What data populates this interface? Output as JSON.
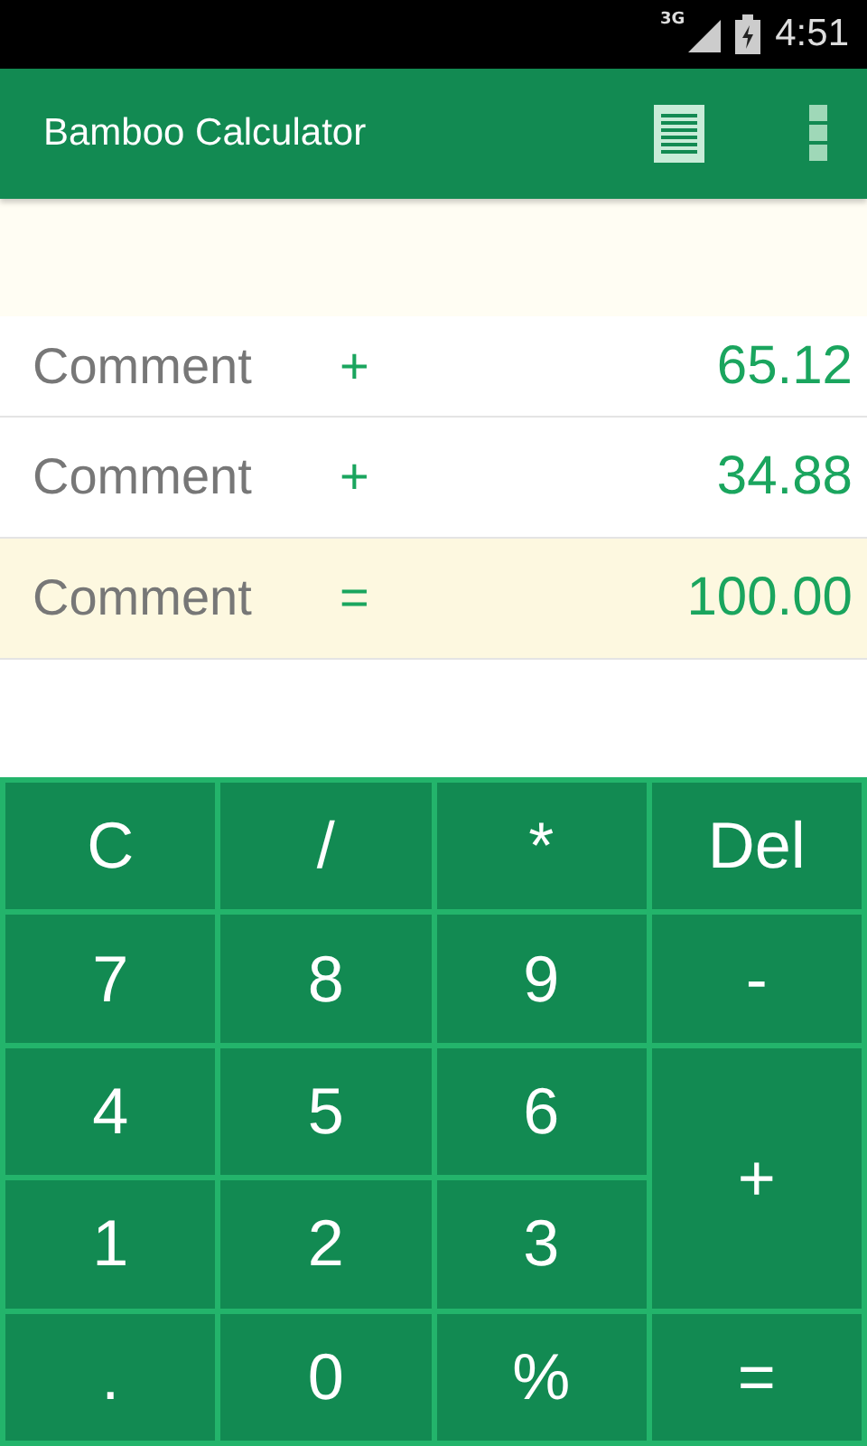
{
  "status_bar": {
    "network": "3G",
    "time": "4:51"
  },
  "app_bar": {
    "title": "Bamboo Calculator"
  },
  "tape": [
    {
      "kind": "entry",
      "comment": "Comment",
      "operator": "+",
      "value": "65.12"
    },
    {
      "kind": "entry",
      "comment": "Comment",
      "operator": "+",
      "value": "34.88"
    },
    {
      "kind": "total",
      "comment": "Comment",
      "operator": "=",
      "value": "100.00"
    }
  ],
  "keypad": [
    {
      "label": "C",
      "kind": "normal"
    },
    {
      "label": "/",
      "kind": "normal"
    },
    {
      "label": "*",
      "kind": "normal"
    },
    {
      "label": "Del",
      "kind": "normal"
    },
    {
      "label": "7",
      "kind": "normal"
    },
    {
      "label": "8",
      "kind": "normal"
    },
    {
      "label": "9",
      "kind": "normal"
    },
    {
      "label": "-",
      "kind": "normal"
    },
    {
      "label": "4",
      "kind": "normal"
    },
    {
      "label": "5",
      "kind": "normal"
    },
    {
      "label": "6",
      "kind": "normal"
    },
    {
      "label": "+",
      "kind": "tall"
    },
    {
      "label": "1",
      "kind": "normal"
    },
    {
      "label": "2",
      "kind": "normal"
    },
    {
      "label": "3",
      "kind": "normal"
    },
    {
      "label": ".",
      "kind": "normal"
    },
    {
      "label": "0",
      "kind": "normal"
    },
    {
      "label": "%",
      "kind": "normal"
    },
    {
      "label": "=",
      "kind": "normal"
    }
  ]
}
